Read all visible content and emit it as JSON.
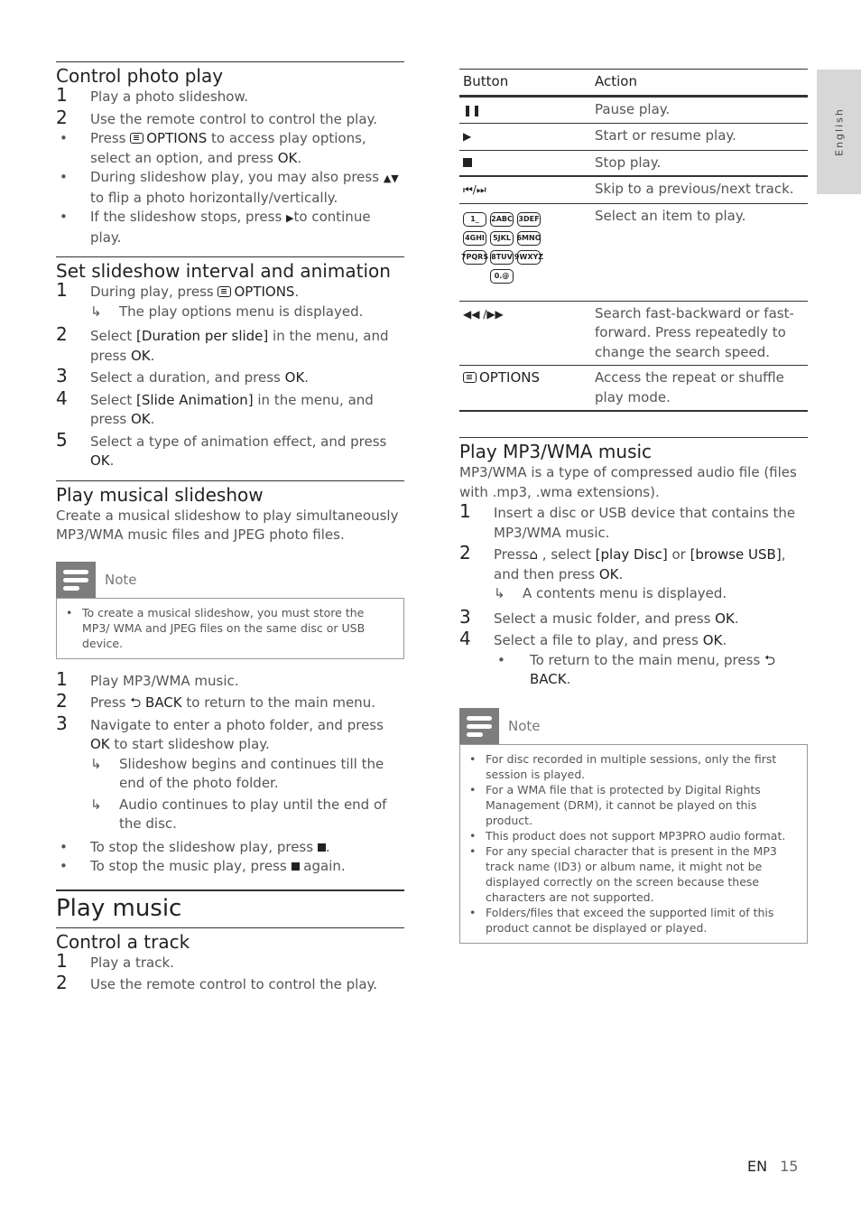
{
  "side_tab": {
    "label": "English"
  },
  "footer": {
    "lang": "EN",
    "page": "15"
  },
  "control_photo_play": {
    "title": "Control photo play",
    "steps": [
      {
        "num": "1",
        "text": "Play a photo slideshow."
      },
      {
        "num": "2",
        "text": "Use the remote control to control the play."
      }
    ],
    "bullets": [
      {
        "pre": "Press ",
        "key": "OPTIONS",
        "mid": " to access play options, select an option, and press ",
        "key2": "OK",
        "post": "."
      },
      {
        "pre": "During slideshow play, you may also press ",
        "icon": "▲▼",
        "post": "to flip a photo horizontally/vertically."
      },
      {
        "pre": "If the slideshow stops, press ",
        "icon": "▶",
        "post": "to continue play."
      }
    ]
  },
  "slideshow_interval": {
    "title": "Set slideshow interval and animation",
    "steps": [
      {
        "num": "1",
        "pre": "During play, press ",
        "key": "OPTIONS",
        "post": "."
      },
      {
        "arrow": "The play options menu is displayed."
      },
      {
        "num": "2",
        "pre": "Select ",
        "key": "[Duration per slide]",
        "mid": " in the menu, and press ",
        "key2": "OK",
        "post": "."
      },
      {
        "num": "3",
        "pre": "Select a duration, and press ",
        "key": "OK",
        "post": "."
      },
      {
        "num": "4",
        "pre": "Select ",
        "key": "[Slide Animation]",
        "mid": " in the menu, and press ",
        "key2": "OK",
        "post": "."
      },
      {
        "num": "5",
        "pre": "Select a type of animation effect, and press ",
        "key": "OK",
        "post": "."
      }
    ]
  },
  "musical_slideshow": {
    "title": "Play musical slideshow",
    "intro": "Create a musical slideshow to play simultaneously MP3/WMA music files and JPEG photo files.",
    "note_label": "Note",
    "note_items": [
      "To create a musical slideshow, you must store the MP3/ WMA and JPEG files on the same disc or USB device."
    ],
    "steps": [
      {
        "num": "1",
        "text": "Play MP3/WMA music."
      },
      {
        "num": "2",
        "pre": "Press ",
        "key": "BACK",
        "post": " to return to the main menu."
      },
      {
        "num": "3",
        "pre": "Navigate to enter a photo folder, and press ",
        "key": "OK",
        "post": " to start slideshow play."
      }
    ],
    "arrows": [
      "Slideshow begins and continues till the end of the photo folder.",
      "Audio continues to play until the end of the disc."
    ],
    "bullets": [
      {
        "pre": "To stop the slideshow play, press ",
        "post": "."
      },
      {
        "pre": "To stop the music play, press ",
        "post": " again."
      }
    ]
  },
  "play_music": {
    "title": "Play music",
    "control_track": {
      "title": "Control a track",
      "steps": [
        {
          "num": "1",
          "text": "Play a track."
        },
        {
          "num": "2",
          "text": "Use the remote control to control the play."
        }
      ]
    }
  },
  "button_table": {
    "headers": [
      "Button",
      "Action"
    ],
    "rows": [
      {
        "button": "pause-icon",
        "action": "Pause play."
      },
      {
        "button": "play-icon",
        "action": "Start or resume play."
      },
      {
        "button": "stop-icon",
        "action": "Stop play."
      },
      {
        "button": "prev-next-icon",
        "action": "Skip to a previous/next track."
      },
      {
        "button": "numeric-keys",
        "action": "Select an item to play.",
        "keys": [
          "1_",
          "2ABC",
          "3DEF",
          "4GHI",
          "5JKL",
          "6MNO",
          "7PQRS",
          "8TUV",
          "9WXYZ",
          "0.@"
        ]
      },
      {
        "button": "rewind-forward-icon",
        "action": "Search fast-backward or fast-forward. Press repeatedly to change the search speed."
      },
      {
        "button": "OPTIONS",
        "action": "Access the repeat or shuffle play mode."
      }
    ]
  },
  "play_mp3": {
    "title": "Play MP3/WMA music",
    "intro": "MP3/WMA is a type of compressed audio file (files with .mp3, .wma extensions).",
    "steps": [
      {
        "num": "1",
        "text": "Insert a disc or USB device that contains the MP3/WMA music."
      },
      {
        "num": "2",
        "pre": "Press",
        "mid": " , select ",
        "key": "[play Disc]",
        "mid2": " or ",
        "key2": "[browse USB]",
        "mid3": ", and then press ",
        "key3": "OK",
        "post": "."
      },
      {
        "arrow": "A contents menu is displayed."
      },
      {
        "num": "3",
        "pre": "Select a music folder, and press ",
        "key": "OK",
        "post": "."
      },
      {
        "num": "4",
        "pre": "Select a file to play, and press ",
        "key": "OK",
        "post": "."
      }
    ],
    "bullet": {
      "pre": "To return to the main menu, press ",
      "key": "BACK",
      "post": "."
    },
    "note_label": "Note",
    "note_items": [
      "For disc recorded in multiple sessions, only the first session is played.",
      "For a WMA file that is protected by Digital Rights Management (DRM), it cannot be played on this product.",
      "This product does not support MP3PRO audio format.",
      "For any special character that is present in the MP3 track name (ID3) or album name, it might not be displayed correctly on the screen because these characters are not supported.",
      "Folders/files that exceed the supported limit of this product cannot be displayed or played."
    ]
  }
}
